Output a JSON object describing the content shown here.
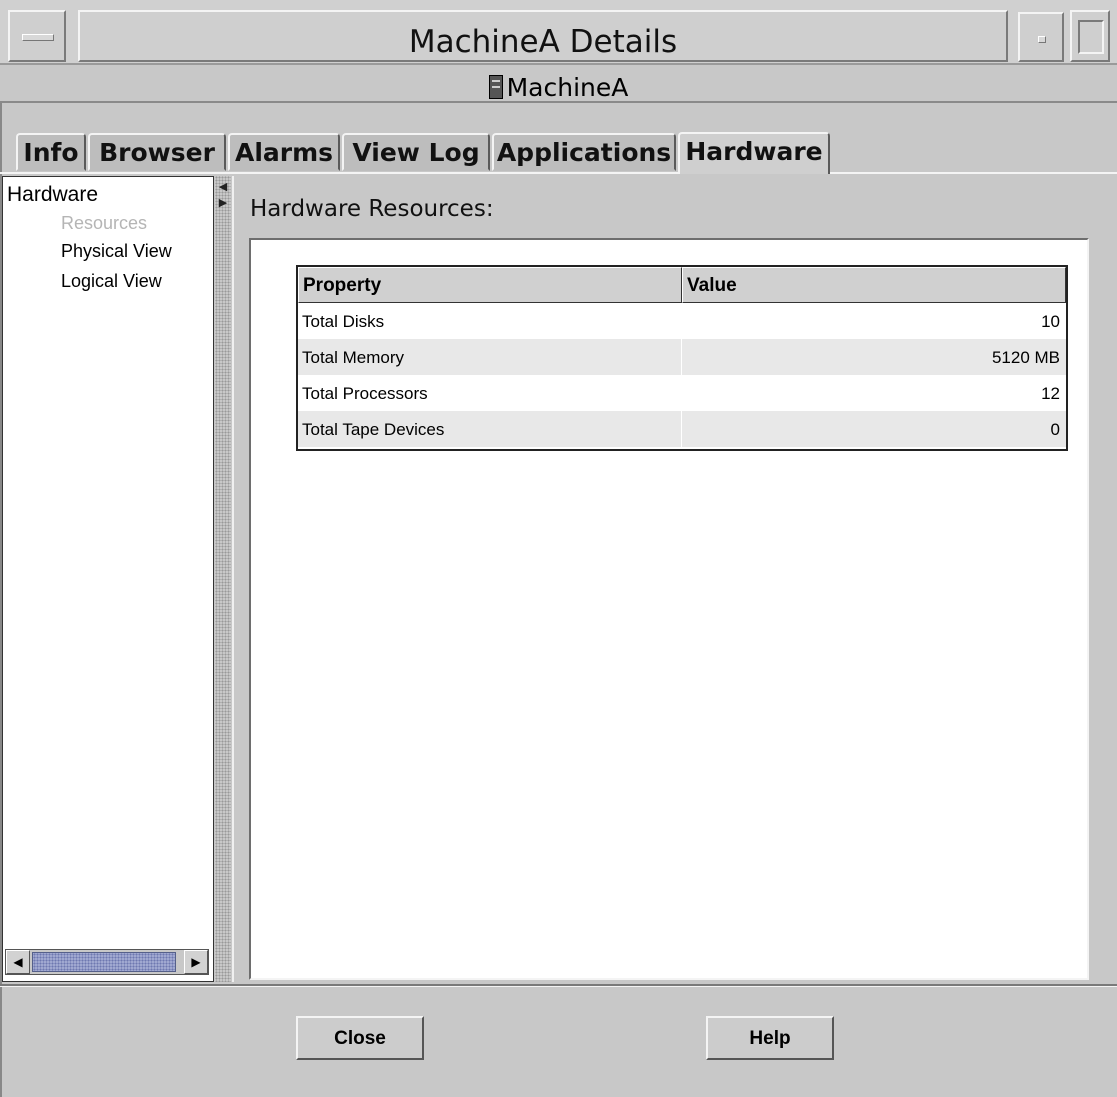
{
  "window": {
    "title": "MachineA Details",
    "machine_name": "MachineA"
  },
  "tabs": [
    {
      "label": "Info"
    },
    {
      "label": "Browser"
    },
    {
      "label": "Alarms"
    },
    {
      "label": "View Log"
    },
    {
      "label": "Applications"
    },
    {
      "label": "Hardware",
      "active": true
    }
  ],
  "nav": {
    "root": "Hardware",
    "items": [
      {
        "label": "Resources",
        "selected": true
      },
      {
        "label": "Physical View"
      },
      {
        "label": "Logical View"
      }
    ]
  },
  "main": {
    "section_title": "Hardware Resources:",
    "table": {
      "headers": [
        "Property",
        "Value"
      ],
      "rows": [
        {
          "property": "Total Disks",
          "value": "10"
        },
        {
          "property": "Total Memory",
          "value": "5120 MB"
        },
        {
          "property": "Total Processors",
          "value": "12"
        },
        {
          "property": "Total Tape Devices",
          "value": "0"
        }
      ]
    }
  },
  "buttons": {
    "close": "Close",
    "help": "Help"
  },
  "colors": {
    "window_bg": "#c8c8c8",
    "panel_bg": "#ffffff",
    "disabled_text": "#b5b5b5",
    "alt_row": "#e8e8e8",
    "scroll_thumb": "#a0a8d0"
  },
  "icons": {
    "machine": "server-icon",
    "window_menu": "window-menu-icon",
    "minimize": "minimize-icon",
    "maximize": "maximize-icon"
  }
}
